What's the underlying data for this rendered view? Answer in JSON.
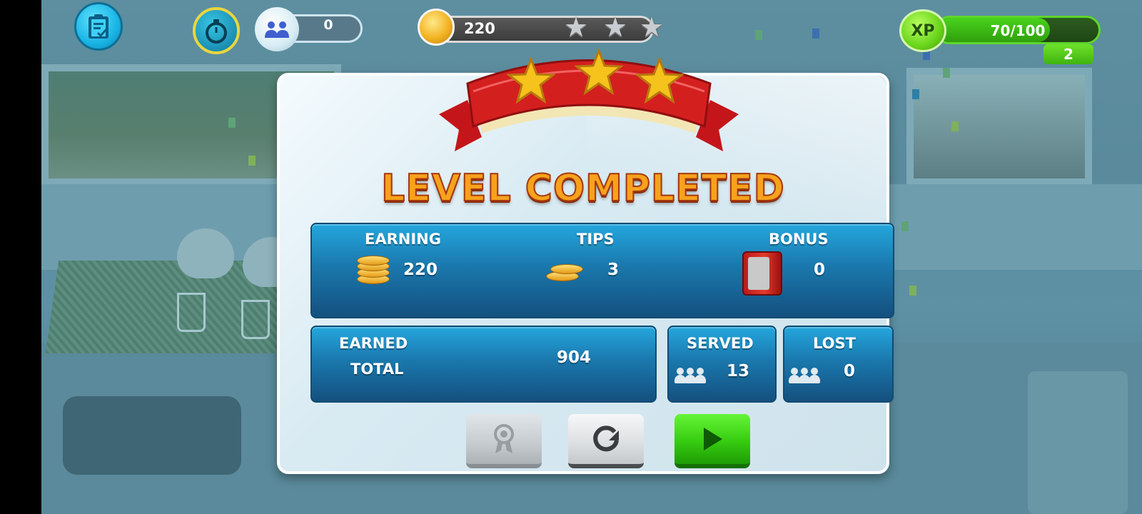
{
  "hud": {
    "clipboard_icon": "clipboard-check-icon",
    "timer_icon": "stopwatch-icon",
    "customers_icon": "people-icon",
    "customers_count": "0",
    "coins": "220",
    "stars_earned": 3,
    "xp_label": "XP",
    "xp_progress": "70/100",
    "xp_fraction": 0.7,
    "level": "2"
  },
  "dialog": {
    "stars": 3,
    "title": "LEVEL COMPLETED",
    "earning_label": "EARNING",
    "earning_value": "220",
    "tips_label": "TIPS",
    "tips_value": "3",
    "bonus_label": "BONUS",
    "bonus_value": "0",
    "earned_label_line1": "EARNED",
    "earned_label_line2": "TOTAL",
    "earned_total": "904",
    "served_label": "SERVED",
    "served_value": "13",
    "lost_label": "LOST",
    "lost_value": "0"
  },
  "buttons": {
    "achievement_icon": "ribbon-award-icon",
    "replay_icon": "replay-arrow-icon",
    "play_icon": "play-triangle-icon"
  },
  "colors": {
    "panel_blue": "#1a78ad",
    "title_orange": "#f7a21d",
    "play_green": "#36cc10",
    "ribbon_red": "#d41f1f",
    "star_gold": "#f6c21c"
  }
}
